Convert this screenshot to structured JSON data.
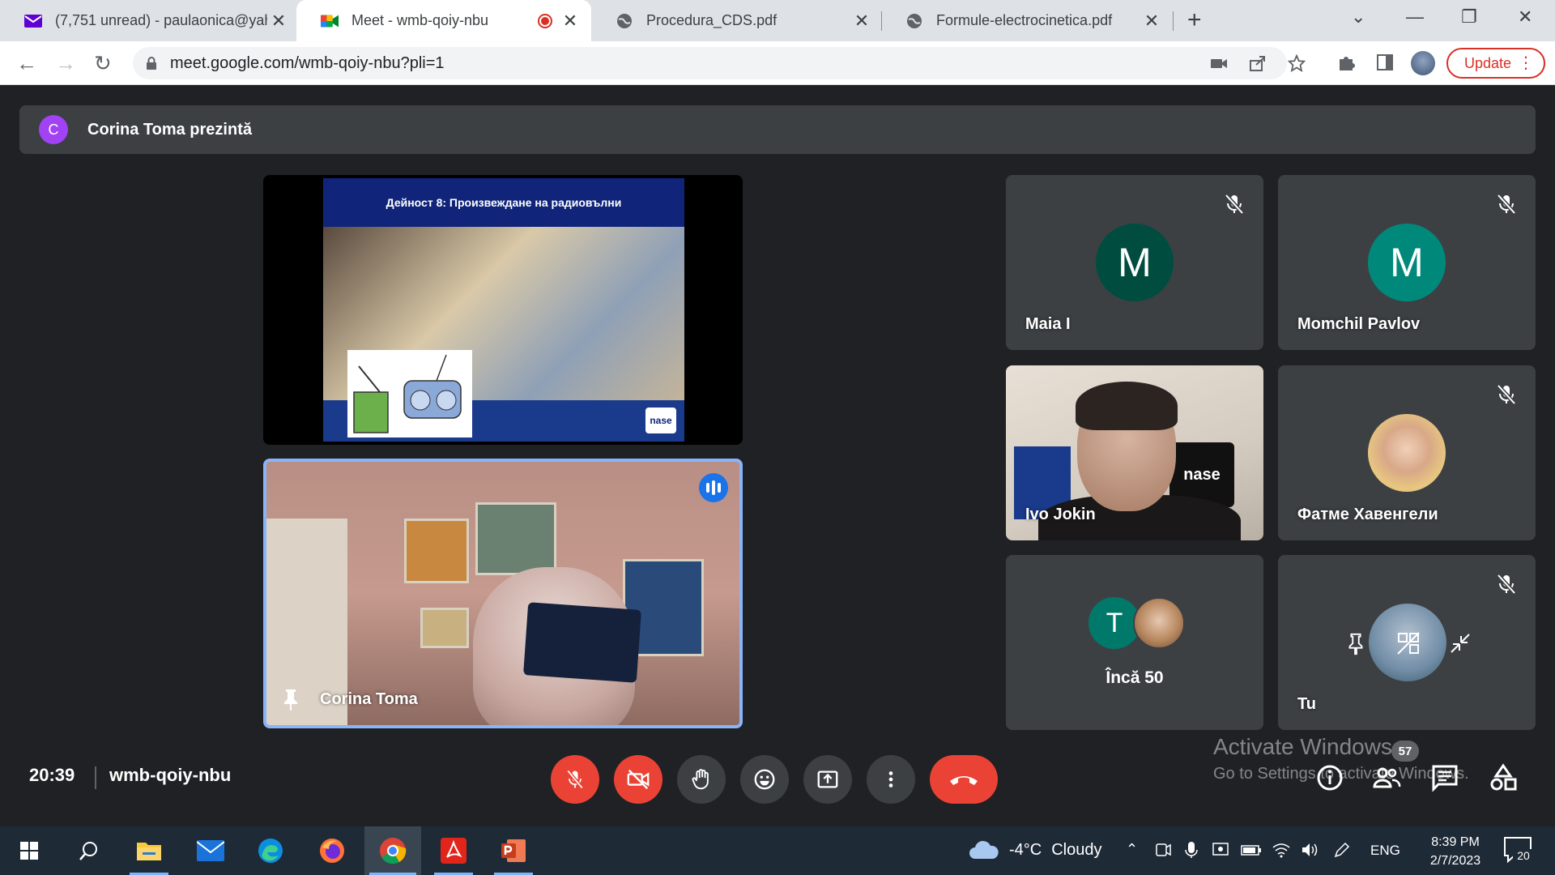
{
  "browser": {
    "tabs": [
      {
        "title": "(7,751 unread) - paulaonica@yah",
        "icon": "yahoo-mail-icon",
        "active": false
      },
      {
        "title": "Meet - wmb-qoiy-nbu",
        "icon": "google-meet-icon",
        "active": true,
        "recording": true
      },
      {
        "title": "Procedura_CDS.pdf",
        "icon": "globe-icon",
        "active": false
      },
      {
        "title": "Formule-electrocinetica.pdf",
        "icon": "globe-icon",
        "active": false
      }
    ],
    "url": "meet.google.com/wmb-qoiy-nbu?pli=1",
    "update_label": "Update"
  },
  "meet": {
    "presenter_initial": "C",
    "presenter_text": "Corina Toma prezintă",
    "slide_title": "Дейност 8: Произвеждане на радиовълни",
    "slide_logo": "nase",
    "speaker_name": "Corina Toma",
    "participants": [
      {
        "name": "Maia I",
        "initial": "M",
        "color": "#004d40",
        "muted": true
      },
      {
        "name": "Momchil Pavlov",
        "initial": "M",
        "color": "#00897b",
        "muted": true
      },
      {
        "name": "Ivo Jokin",
        "muted": false
      },
      {
        "name": "Фатме Хавенгели",
        "muted": true
      },
      {
        "name": "Încă 50",
        "initial": "T",
        "color": "#00796b"
      },
      {
        "name": "Tu",
        "muted": true
      }
    ],
    "ivo_poster": "nase",
    "time": "20:39",
    "meeting_code": "wmb-qoiy-nbu",
    "participant_count": "57",
    "watermark_line1": "Activate Windows",
    "watermark_line2": "Go to Settings to activate Windows."
  },
  "taskbar": {
    "weather_temp": "-4°C",
    "weather_cond": "Cloudy",
    "lang": "ENG",
    "time": "8:39 PM",
    "date": "2/7/2023",
    "notifications": "20"
  }
}
